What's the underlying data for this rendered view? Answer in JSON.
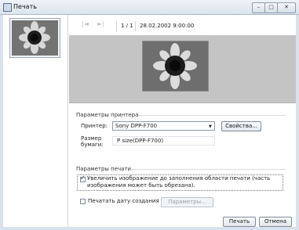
{
  "window": {
    "title": "Печать",
    "minimize_glyph": "–",
    "maximize_glyph": "□",
    "close_glyph": "✕"
  },
  "nav": {
    "page_indicator": "1 / 1",
    "datetime": "28.02.2002 9:00:00",
    "first_glyph": "|◄",
    "next_glyph": "►|"
  },
  "printer_settings": {
    "section_title": "Параметры принтера",
    "printer_label": "Принтер:",
    "printer_value": "Sony DPP-F700",
    "properties_button": "Свойства...",
    "paper_size_label_1": "Размер",
    "paper_size_label_2": "бумаги:",
    "paper_size_value": "P size(DPP-F700)"
  },
  "print_settings": {
    "section_title": "Параметры печати",
    "fit_to_page_label": "Увеличить изображение до заполнения области печати (часть изображения может быть обрезана).",
    "fit_to_page_checked": true,
    "print_date_label": "Печатать дату создания",
    "print_date_checked": false,
    "parameters_button": "Параметры..."
  },
  "buttons": {
    "print": "Печать",
    "cancel": "Отмена"
  }
}
